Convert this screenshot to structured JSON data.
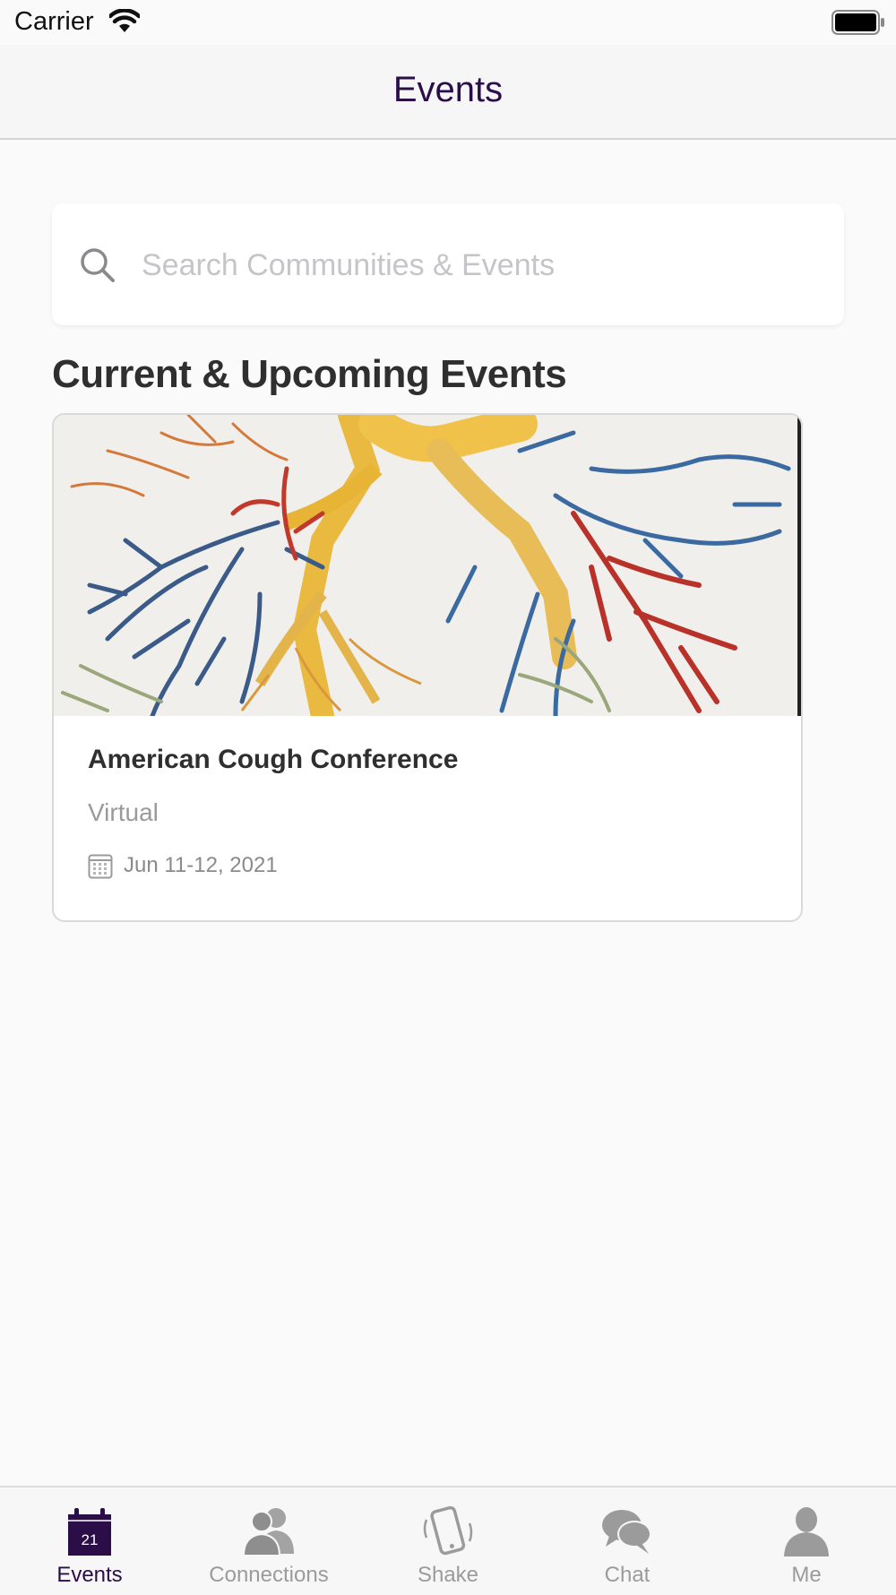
{
  "status_bar": {
    "carrier": "Carrier"
  },
  "nav": {
    "title": "Events"
  },
  "search": {
    "placeholder": "Search Communities & Events",
    "value": ""
  },
  "section": {
    "title": "Current & Upcoming Events"
  },
  "events": [
    {
      "name": "American Cough Conference",
      "location": "Virtual",
      "date": "Jun 11-12, 2021"
    }
  ],
  "tabs": [
    {
      "label": "Events",
      "icon": "calendar-icon",
      "day": "21",
      "active": true
    },
    {
      "label": "Connections",
      "icon": "people-icon",
      "active": false
    },
    {
      "label": "Shake",
      "icon": "phone-shake-icon",
      "active": false
    },
    {
      "label": "Chat",
      "icon": "chat-bubbles-icon",
      "active": false
    },
    {
      "label": "Me",
      "icon": "person-icon",
      "active": false
    }
  ],
  "colors": {
    "accent": "#2b0e48",
    "inactive": "#9b9b9b"
  }
}
